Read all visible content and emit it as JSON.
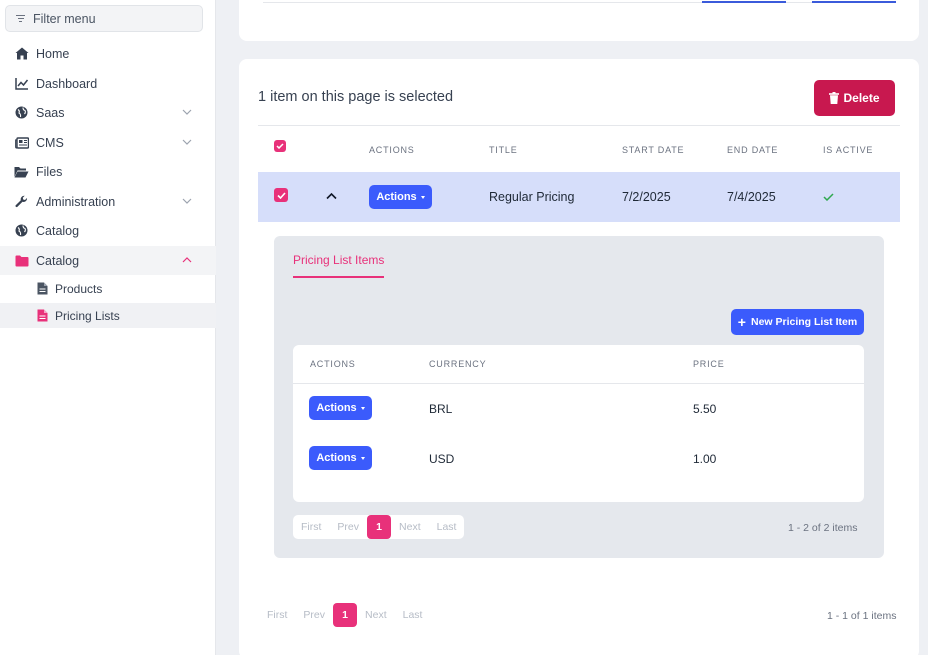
{
  "sidebar": {
    "filter_label": "Filter menu",
    "items": [
      {
        "label": "Home",
        "icon": "home-icon"
      },
      {
        "label": "Dashboard",
        "icon": "chart-line-icon"
      },
      {
        "label": "Saas",
        "icon": "globe-icon"
      },
      {
        "label": "CMS",
        "icon": "newspaper-icon"
      },
      {
        "label": "Files",
        "icon": "folder-open-icon"
      },
      {
        "label": "Administration",
        "icon": "wrench-icon"
      },
      {
        "label": "Catalog",
        "icon": "globe-icon"
      },
      {
        "label": "Catalog",
        "icon": "folder-icon"
      }
    ],
    "sub_items": [
      {
        "label": "Products",
        "icon": "file-icon"
      },
      {
        "label": "Pricing Lists",
        "icon": "file-text-icon"
      }
    ]
  },
  "main": {
    "selection_text": "1 item on this page is selected",
    "delete_label": "Delete",
    "table": {
      "headers": [
        "ACTIONS",
        "TITLE",
        "START DATE",
        "END DATE",
        "IS ACTIVE"
      ],
      "row": {
        "actions_label": "Actions",
        "title": "Regular Pricing",
        "start_date": "7/2/2025",
        "end_date": "7/4/2025"
      }
    },
    "detail": {
      "tab_label": "Pricing List Items",
      "new_button_label": "New Pricing List Item",
      "headers": [
        "ACTIONS",
        "CURRENCY",
        "PRICE"
      ],
      "rows": [
        {
          "actions_label": "Actions",
          "currency": "BRL",
          "price": "5.50"
        },
        {
          "actions_label": "Actions",
          "currency": "USD",
          "price": "1.00"
        }
      ],
      "pager": {
        "first": "First",
        "prev": "Prev",
        "current": "1",
        "next": "Next",
        "last": "Last"
      },
      "count": "1 - 2 of 2 items"
    },
    "pager": {
      "first": "First",
      "prev": "Prev",
      "current": "1",
      "next": "Next",
      "last": "Last"
    },
    "count": "1 - 1 of 1 items"
  },
  "colors": {
    "accent": "#e8317a",
    "primary": "#3b5bfc",
    "danger": "#c8184f",
    "selected_row": "#d6defa"
  }
}
